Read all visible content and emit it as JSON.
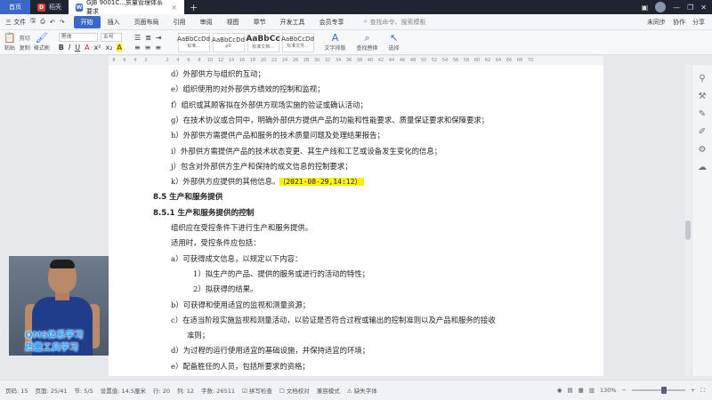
{
  "titlebar": {
    "tabs": [
      {
        "label": "首页",
        "kind": "home"
      },
      {
        "label": "稻壳",
        "kind": "docer",
        "badge": "D"
      },
      {
        "label": "GJB 9001C...质量管理体系 要求",
        "kind": "doc",
        "badge": "W"
      }
    ],
    "new_tab": "+"
  },
  "menubar": {
    "file": "三 文件",
    "items": [
      "开始",
      "插入",
      "页面布局",
      "引用",
      "审阅",
      "视图",
      "章节",
      "开发工具",
      "会员专享"
    ],
    "active_index": 0,
    "search_placeholder": "查找命令、搜索模板",
    "right": [
      "未同步",
      "协作",
      "分享"
    ]
  },
  "ribbon": {
    "clipboard": [
      "粘贴",
      "剪切",
      "复制",
      "格式刷"
    ],
    "font_name": "黑体",
    "font_size": "五号",
    "styles": [
      {
        "sample": "AaBbCcDd",
        "name": "标准..."
      },
      {
        "sample": "AaBbCcDd",
        "name": "p0"
      },
      {
        "sample": "AaBbCc",
        "name": "标准文档..."
      },
      {
        "sample": "AaBbCcDd",
        "name": "标准文件..."
      }
    ],
    "tools": [
      "文字排版",
      "查找替换",
      "选择"
    ]
  },
  "ruler": {
    "ticks": [
      "8",
      "6",
      "4",
      "2",
      "",
      "2",
      "4",
      "6",
      "8",
      "10",
      "12",
      "14",
      "16",
      "18",
      "20",
      "22",
      "24",
      "26",
      "28",
      "30",
      "32",
      "34",
      "36",
      "38",
      "40",
      "42",
      "44",
      "46",
      "48",
      "50",
      "52",
      "54",
      "56",
      "58",
      "60",
      "62",
      "64",
      "66",
      "68",
      "70"
    ]
  },
  "document": {
    "lines": [
      {
        "text": "d）外部供方与组织的互动；"
      },
      {
        "text": "e）组织使用的对外部供方绩效的控制和监视；"
      },
      {
        "text": "f）组织或其顾客拟在外部供方现场实施的验证或确认活动；"
      },
      {
        "text": "g）在技术协议或合同中，明确外部供方提供产品的功能和性能要求、质量保证要求和保障要求；"
      },
      {
        "text": "h）外部供方需提供产品和服务的技术质量问题及处理结果报告；"
      },
      {
        "text": "i）外部供方需提供产品的技术状态变更、其生产线和工艺或设备发生变化的信息；"
      },
      {
        "text": "j）包含对外部供方生产和保持的成文信息的控制要求；"
      },
      {
        "text": "k）外部供方应提供的其他信息。",
        "highlight": "（2021-08-29,14:12）"
      },
      {
        "text": "8.5 生产和服务提供",
        "heading": true
      },
      {
        "text": "8.5.1 生产和服务提供的控制",
        "heading": true
      },
      {
        "text": "组织应在受控条件下进行生产和服务提供。"
      },
      {
        "text": "适用时，受控条件应包括："
      },
      {
        "text": "a）可获得成文信息，以规定以下内容："
      },
      {
        "text": "1）拟生产的产品、提供的服务或进行的活动的特性；"
      },
      {
        "text": "2）拟获得的结果。"
      },
      {
        "text": "b）可获得和使用适宜的监视和测量资源；"
      },
      {
        "text": "c）在适当阶段实施监视和测量活动，以验证是否符合过程或输出的控制准则以及产品和服务的接收"
      },
      {
        "text": "准则；"
      },
      {
        "text": "d）为过程的运行使用适宜的基础设施，并保持适宜的环境；"
      },
      {
        "text": "e）配备胜任的人员，包括所要求的资格；"
      },
      {
        "text": "f）若输出结果不能由后续的监视或测量加以验证，应对生产和服务提供过程实施策划结果的能力进"
      }
    ]
  },
  "overlay": {
    "caption1": "QMS体系学习",
    "caption2": "质量工具学习"
  },
  "status": {
    "items": [
      "页码: 15",
      "页面: 25/41",
      "节: 5/5",
      "设置值: 14.5厘米",
      "行: 20",
      "列: 12",
      "字数: 26511"
    ],
    "spell": "拼写检查",
    "compare": "文档校对",
    "compat": "兼容模式",
    "font_missing": "缺失字体",
    "zoom": "130%",
    "zoom_level": 0.62
  },
  "colors": {
    "accent": "#3b67c8",
    "highlight": "#fff200",
    "caption": "#2fa0ff"
  }
}
